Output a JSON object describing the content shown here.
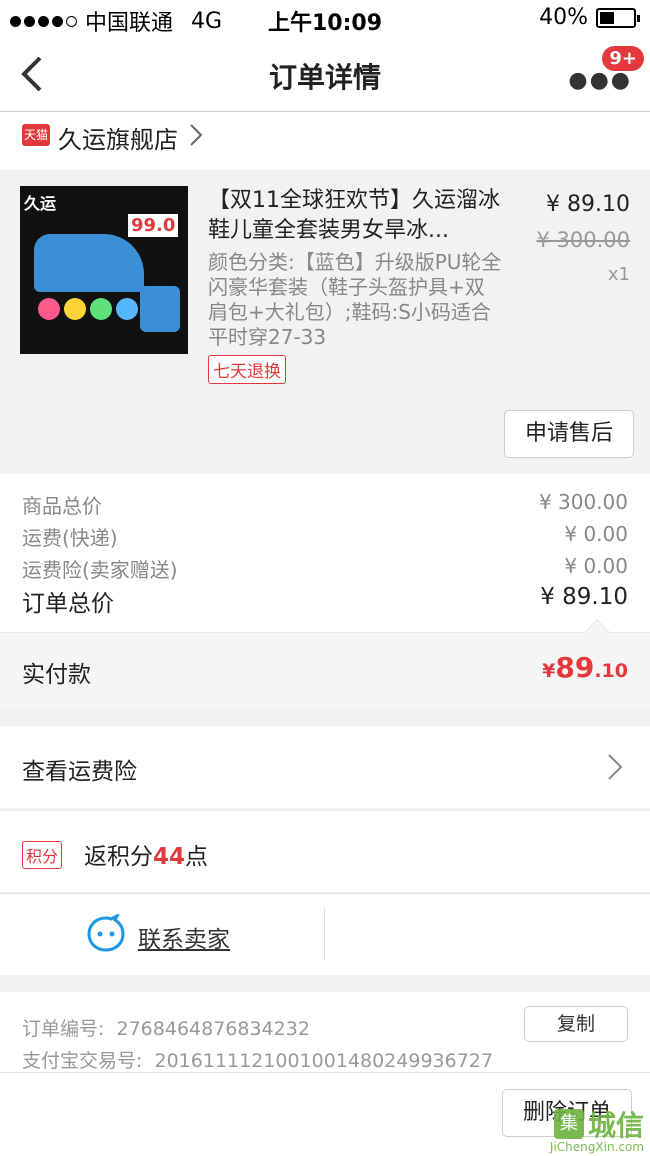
{
  "status": {
    "carrier": "中国联通",
    "network": "4G",
    "time": "上午10:09",
    "battery": "40%"
  },
  "nav": {
    "title": "订单详情",
    "badge": "9+",
    "back_icon": "chevron-left-icon",
    "more_icon": "more-dots-icon"
  },
  "shop": {
    "tmall_label": "天猫",
    "name": "久运旗舰店"
  },
  "item": {
    "title": "【双11全球狂欢节】久运溜冰鞋儿童全套装男女旱冰...",
    "sku": "颜色分类:【蓝色】升级版PU轮全闪豪华套装（鞋子头盔护具+双肩包+大礼包）;鞋码:S小码适合平时穿27-33",
    "return_tag": "七天退换",
    "price": "¥ 89.10",
    "original_price": "¥ 300.00",
    "quantity": "x1",
    "after_sale_label": "申请售后",
    "thumb_logo": "久运",
    "thumb_price": "99.0"
  },
  "summary": {
    "rows": [
      {
        "label": "商品总价",
        "value": "¥ 300.00"
      },
      {
        "label": "运费(快递)",
        "value": "¥ 0.00"
      },
      {
        "label": "运费险(卖家赠送)",
        "value": "¥ 0.00"
      }
    ],
    "total_label": "订单总价",
    "total_value": "¥ 89.10"
  },
  "paid": {
    "label": "实付款",
    "currency": "¥",
    "amount_int": "89",
    "amount_dec": ".10"
  },
  "freight_insurance": {
    "label": "查看运费险"
  },
  "points": {
    "tag": "积分",
    "text_prefix": "返积分",
    "value": "44",
    "text_suffix": "点"
  },
  "contact": {
    "label": "联系卖家"
  },
  "order_info": {
    "order_no_label": "订单编号:",
    "order_no": "2768464876834232",
    "alipay_label": "支付宝交易号:",
    "alipay_no": "2016111121001001480249936727",
    "copy_label": "复制"
  },
  "footer": {
    "delete_label": "删除订单"
  },
  "watermark": {
    "text": "城信",
    "site": "JiChengXin.com"
  },
  "colors": {
    "accent": "#e4393c",
    "muted": "#888888"
  }
}
